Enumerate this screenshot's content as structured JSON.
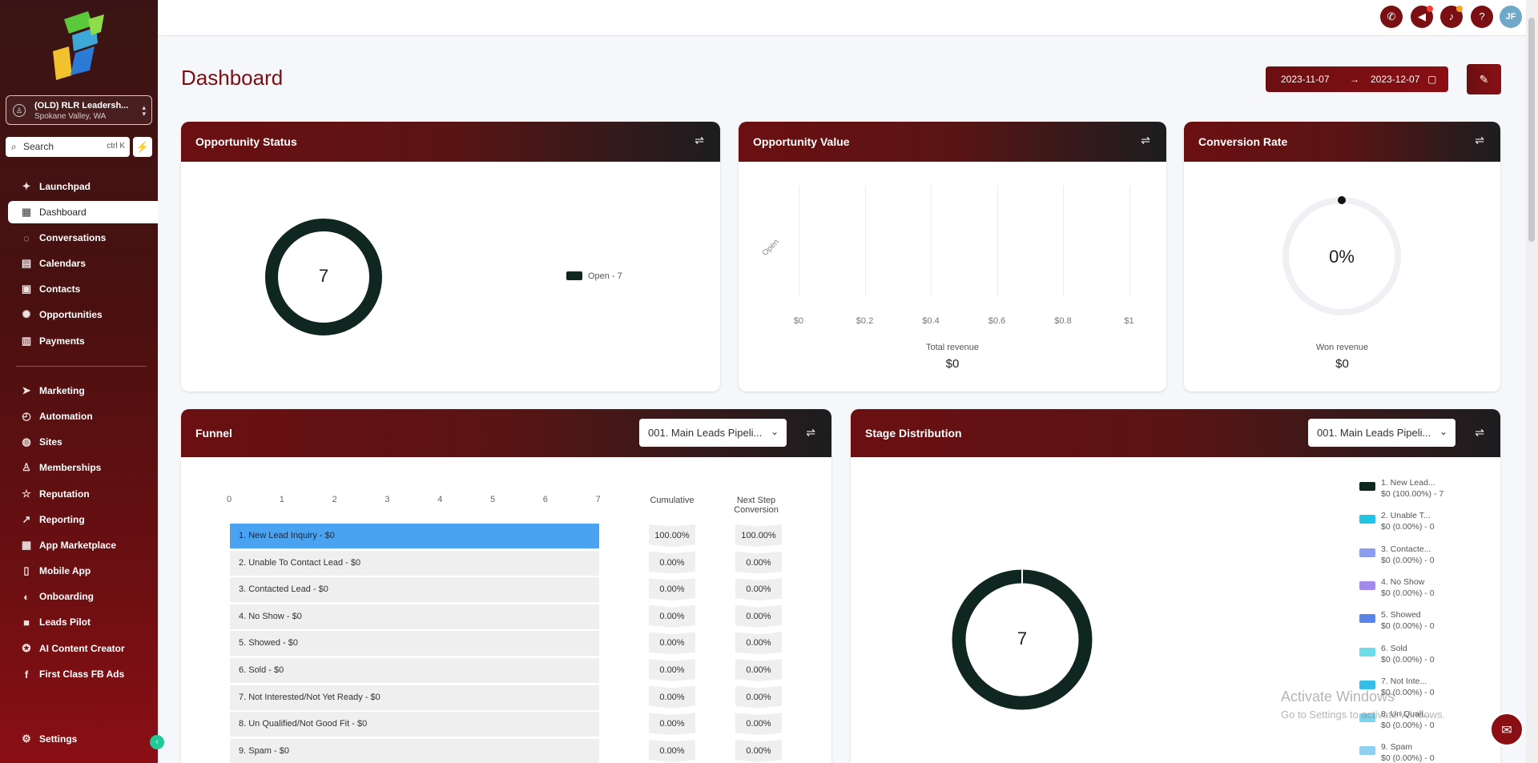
{
  "colors": {
    "brand": "#7a0f14",
    "dark_series": "#102620",
    "highlight": "#4aa3f0",
    "accent_green": "#20c997"
  },
  "sidebar": {
    "location_name": "(OLD) RLR Leadersh...",
    "location_sub": "Spokane Valley, WA",
    "search_placeholder": "Search",
    "search_shortcut": "ctrl K",
    "items": [
      {
        "label": "Launchpad",
        "icon": "rocket-icon",
        "glyph": "✦"
      },
      {
        "label": "Dashboard",
        "icon": "grid-icon",
        "glyph": "▦"
      },
      {
        "label": "Conversations",
        "icon": "chat-icon",
        "glyph": "◌"
      },
      {
        "label": "Calendars",
        "icon": "calendar-icon",
        "glyph": "▤"
      },
      {
        "label": "Contacts",
        "icon": "contacts-icon",
        "glyph": "▣"
      },
      {
        "label": "Opportunities",
        "icon": "opportunities-icon",
        "glyph": "✺"
      },
      {
        "label": "Payments",
        "icon": "payments-icon",
        "glyph": "▥"
      },
      {
        "label": "Marketing",
        "icon": "send-icon",
        "glyph": "➤"
      },
      {
        "label": "Automation",
        "icon": "automation-icon",
        "glyph": "◴"
      },
      {
        "label": "Sites",
        "icon": "globe-icon",
        "glyph": "◍"
      },
      {
        "label": "Memberships",
        "icon": "memberships-icon",
        "glyph": "♙"
      },
      {
        "label": "Reputation",
        "icon": "star-icon",
        "glyph": "☆"
      },
      {
        "label": "Reporting",
        "icon": "chart-line-icon",
        "glyph": "↗"
      },
      {
        "label": "App Marketplace",
        "icon": "apps-icon",
        "glyph": "▦"
      },
      {
        "label": "Mobile App",
        "icon": "mobile-icon",
        "glyph": "▯"
      },
      {
        "label": "Onboarding",
        "icon": "onboarding-icon",
        "glyph": "◐"
      },
      {
        "label": "Leads Pilot",
        "icon": "leads-icon",
        "glyph": "■"
      },
      {
        "label": "AI Content Creator",
        "icon": "ai-icon",
        "glyph": "✪"
      },
      {
        "label": "First Class FB Ads",
        "icon": "facebook-icon",
        "glyph": "f"
      }
    ],
    "settings_label": "Settings"
  },
  "header": {
    "title": "Dashboard",
    "date_start": "2023-11-07",
    "date_end": "2023-12-07"
  },
  "topbar": {
    "avatar_initials": "JF"
  },
  "opportunity_status": {
    "title": "Opportunity Status",
    "center_value": "7",
    "legend": "Open - 7"
  },
  "opportunity_value": {
    "title": "Opportunity Value",
    "y_label": "Open",
    "x_ticks": [
      "$0",
      "$0.2",
      "$0.4",
      "$0.6",
      "$0.8",
      "$1"
    ],
    "footer_label": "Total revenue",
    "footer_value": "$0"
  },
  "conversion_rate": {
    "title": "Conversion Rate",
    "center_value": "0%",
    "footer_label": "Won revenue",
    "footer_value": "$0"
  },
  "funnel": {
    "title": "Funnel",
    "pipeline": "001. Main Leads Pipeli...",
    "axis": [
      "0",
      "1",
      "2",
      "3",
      "4",
      "5",
      "6",
      "7"
    ],
    "col_cumulative": "Cumulative",
    "col_next": "Next Step Conversion",
    "rows": [
      {
        "label": "1. New Lead Inquiry - $0",
        "cumulative": "100.00%",
        "next": "100.00%"
      },
      {
        "label": "2. Unable To Contact Lead - $0",
        "cumulative": "0.00%",
        "next": "0.00%"
      },
      {
        "label": "3. Contacted Lead - $0",
        "cumulative": "0.00%",
        "next": "0.00%"
      },
      {
        "label": "4. No Show - $0",
        "cumulative": "0.00%",
        "next": "0.00%"
      },
      {
        "label": "5. Showed - $0",
        "cumulative": "0.00%",
        "next": "0.00%"
      },
      {
        "label": "6. Sold - $0",
        "cumulative": "0.00%",
        "next": "0.00%"
      },
      {
        "label": "7. Not Interested/Not Yet Ready - $0",
        "cumulative": "0.00%",
        "next": "0.00%"
      },
      {
        "label": "8. Un Qualified/Not Good Fit - $0",
        "cumulative": "0.00%",
        "next": "0.00%"
      },
      {
        "label": "9. Spam - $0",
        "cumulative": "0.00%",
        "next": "0.00%"
      }
    ]
  },
  "stage_distribution": {
    "title": "Stage Distribution",
    "pipeline": "001. Main Leads Pipeli...",
    "center_value": "7",
    "legend": [
      {
        "name": "1. New Lead...",
        "value": "$0 (100.00%) - 7",
        "color": "#102620"
      },
      {
        "name": "2. Unable T...",
        "value": "$0 (0.00%) - 0",
        "color": "#22c4e6"
      },
      {
        "name": "3. Contacte...",
        "value": "$0 (0.00%) - 0",
        "color": "#8b9df0"
      },
      {
        "name": "4. No Show",
        "value": "$0 (0.00%) - 0",
        "color": "#a08bea"
      },
      {
        "name": "5. Showed",
        "value": "$0 (0.00%) - 0",
        "color": "#5a84e8"
      },
      {
        "name": "6. Sold",
        "value": "$0 (0.00%) - 0",
        "color": "#6ddde8"
      },
      {
        "name": "7. Not Inte...",
        "value": "$0 (0.00%) - 0",
        "color": "#36bde8"
      },
      {
        "name": "8. Un Quali...",
        "value": "$0 (0.00%) - 0",
        "color": "#7cd6f0"
      },
      {
        "name": "9. Spam",
        "value": "$0 (0.00%) - 0",
        "color": "#8fd0f2"
      }
    ]
  },
  "os_watermark": {
    "line1": "Activate Windows",
    "line2": "Go to Settings to activate Windows."
  }
}
